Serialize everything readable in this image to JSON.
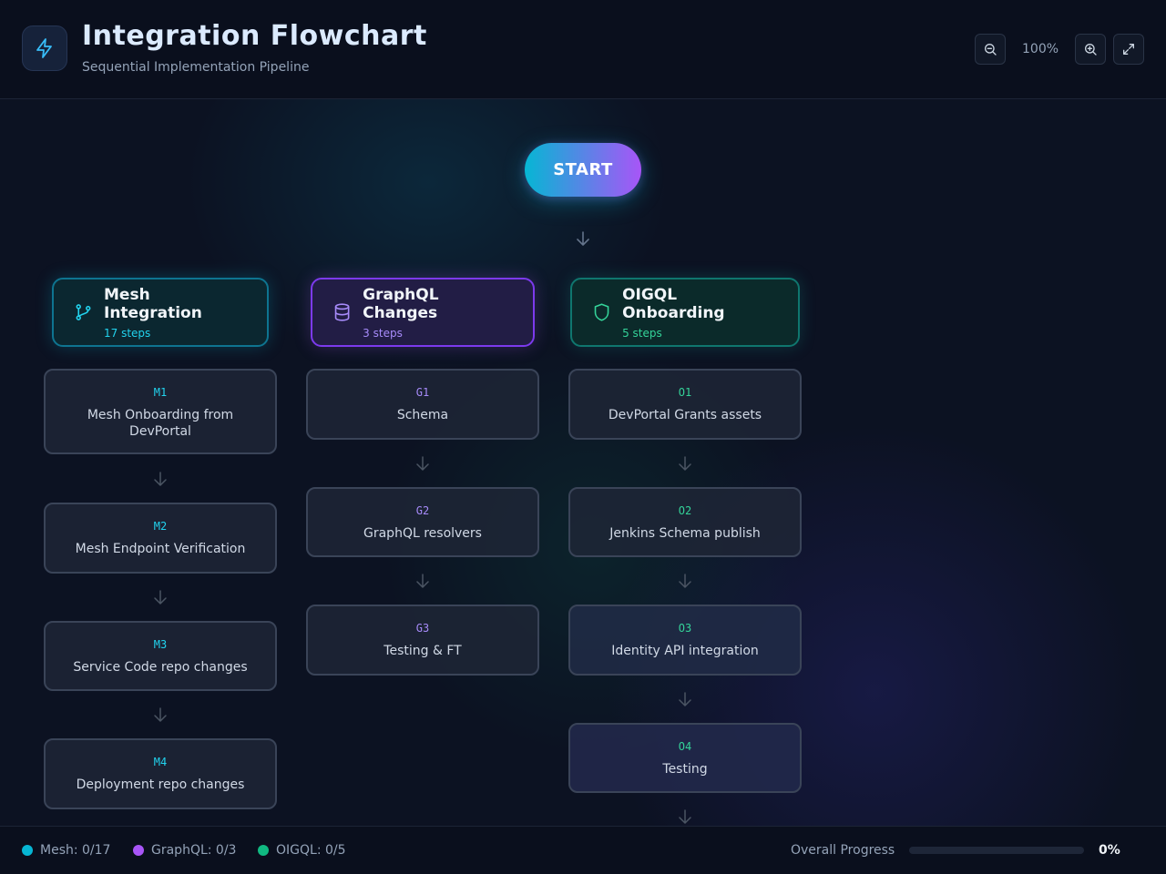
{
  "header": {
    "title": "Integration Flowchart",
    "subtitle": "Sequential Implementation Pipeline",
    "zoom": "100%",
    "logo_icon": "lightning-icon",
    "zoom_out_icon": "zoom-out-icon",
    "zoom_in_icon": "zoom-in-icon",
    "fullscreen_icon": "expand-icon"
  },
  "start_label": "START",
  "columns": {
    "mesh": {
      "name": "Mesh Integration",
      "steps": "17 steps",
      "icon": "git-branch-icon",
      "color": "#22d3ee",
      "cards": [
        {
          "code": "M1",
          "label": "Mesh Onboarding from DevPortal"
        },
        {
          "code": "M2",
          "label": "Mesh Endpoint Verification"
        },
        {
          "code": "M3",
          "label": "Service Code repo changes"
        },
        {
          "code": "M4",
          "label": "Deployment repo changes"
        }
      ]
    },
    "graphql": {
      "name": "GraphQL Changes",
      "steps": "3 steps",
      "icon": "database-icon",
      "color": "#a78bfa",
      "cards": [
        {
          "code": "G1",
          "label": "Schema"
        },
        {
          "code": "G2",
          "label": "GraphQL resolvers"
        },
        {
          "code": "G3",
          "label": "Testing & FT"
        }
      ]
    },
    "oigql": {
      "name": "OIGQL Onboarding",
      "steps": "5 steps",
      "icon": "shield-icon",
      "color": "#34d399",
      "cards": [
        {
          "code": "O1",
          "label": "DevPortal Grants assets"
        },
        {
          "code": "O2",
          "label": "Jenkins Schema publish"
        },
        {
          "code": "O3",
          "label": "Identity API integration"
        },
        {
          "code": "O4",
          "label": "Testing"
        }
      ]
    }
  },
  "footer": {
    "legend": [
      {
        "label": "Mesh: 0/17",
        "color": "#06b6d4"
      },
      {
        "label": "GraphQL: 0/3",
        "color": "#a855f7"
      },
      {
        "label": "OIGQL: 0/5",
        "color": "#10b981"
      }
    ],
    "progress_label": "Overall Progress",
    "progress_percent": "0%",
    "progress_value": 0
  }
}
